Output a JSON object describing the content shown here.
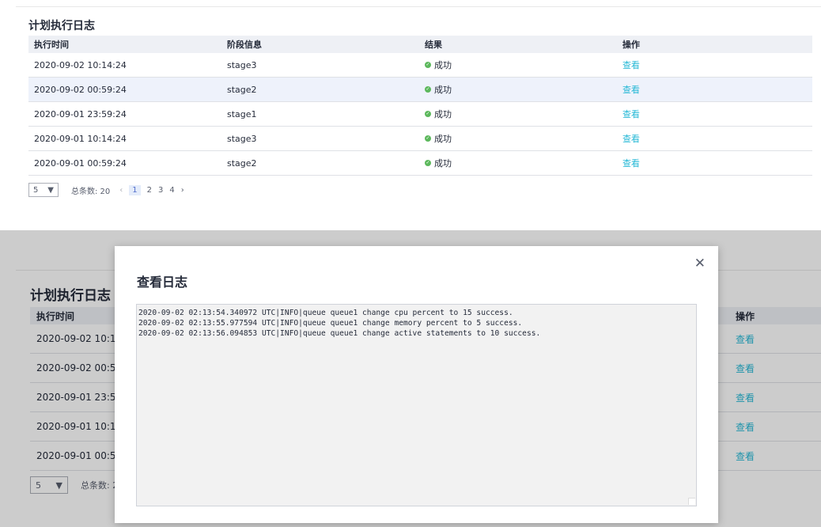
{
  "section_title": "计划执行日志",
  "columns": [
    "执行时间",
    "阶段信息",
    "结果",
    "操作"
  ],
  "rows": [
    {
      "time": "2020-09-02 10:14:24",
      "stage": "stage3",
      "result": "成功",
      "action": "查看"
    },
    {
      "time": "2020-09-02 00:59:24",
      "stage": "stage2",
      "result": "成功",
      "action": "查看"
    },
    {
      "time": "2020-09-01 23:59:24",
      "stage": "stage1",
      "result": "成功",
      "action": "查看"
    },
    {
      "time": "2020-09-01 10:14:24",
      "stage": "stage3",
      "result": "成功",
      "action": "查看"
    },
    {
      "time": "2020-09-01 00:59:24",
      "stage": "stage2",
      "result": "成功",
      "action": "查看"
    }
  ],
  "pagination": {
    "page_size": "5",
    "total_label": "总条数: 20",
    "total_label_partial": "总条数: 2",
    "pages": [
      "1",
      "2",
      "3",
      "4"
    ],
    "current_page": "1"
  },
  "modal": {
    "title": "查看日志",
    "log_lines": [
      "2020-09-02 02:13:54.340972 UTC|INFO|queue queue1 change cpu percent to 15 success.",
      "2020-09-02 02:13:55.977594 UTC|INFO|queue queue1 change memory percent to 5 success.",
      "2020-09-02 02:13:56.094853 UTC|INFO|queue queue1 change active statements to 10 success."
    ]
  },
  "colors": {
    "link": "#26b8d6",
    "success": "#5cb85c",
    "header_bg": "#eef0f5",
    "highlight_row": "#eef2fb"
  },
  "icons": {
    "success": "check-circle-icon",
    "dropdown": "caret-down-icon",
    "prev": "chevron-left-icon",
    "next": "chevron-right-icon",
    "close": "close-icon"
  }
}
